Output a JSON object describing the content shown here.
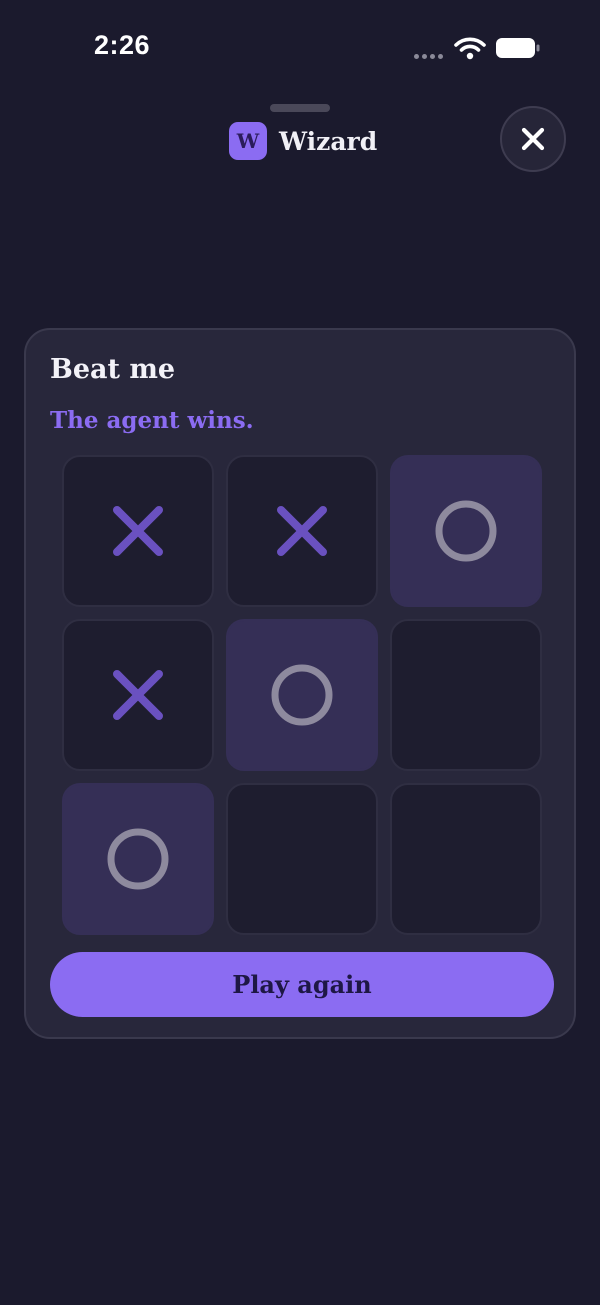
{
  "status_bar": {
    "time": "2:26",
    "icons": [
      "signal-dots-icon",
      "wifi-icon",
      "battery-icon"
    ]
  },
  "header": {
    "logo_letter": "W",
    "title": "Wizard",
    "close_icon": "close-icon"
  },
  "game": {
    "title": "Beat me",
    "status": "The agent wins.",
    "board": [
      "X",
      "X",
      "O",
      "X",
      "O",
      "",
      "O",
      "",
      ""
    ],
    "winning_cells": [
      2,
      4,
      6
    ],
    "play_again_label": "Play again"
  },
  "colors": {
    "background": "#1b1a2d",
    "card": "#28273b",
    "accent": "#8b6cf2",
    "x_mark": "#6a51c0",
    "o_mark": "#8e8a9e",
    "win_cell": "#352f56"
  }
}
